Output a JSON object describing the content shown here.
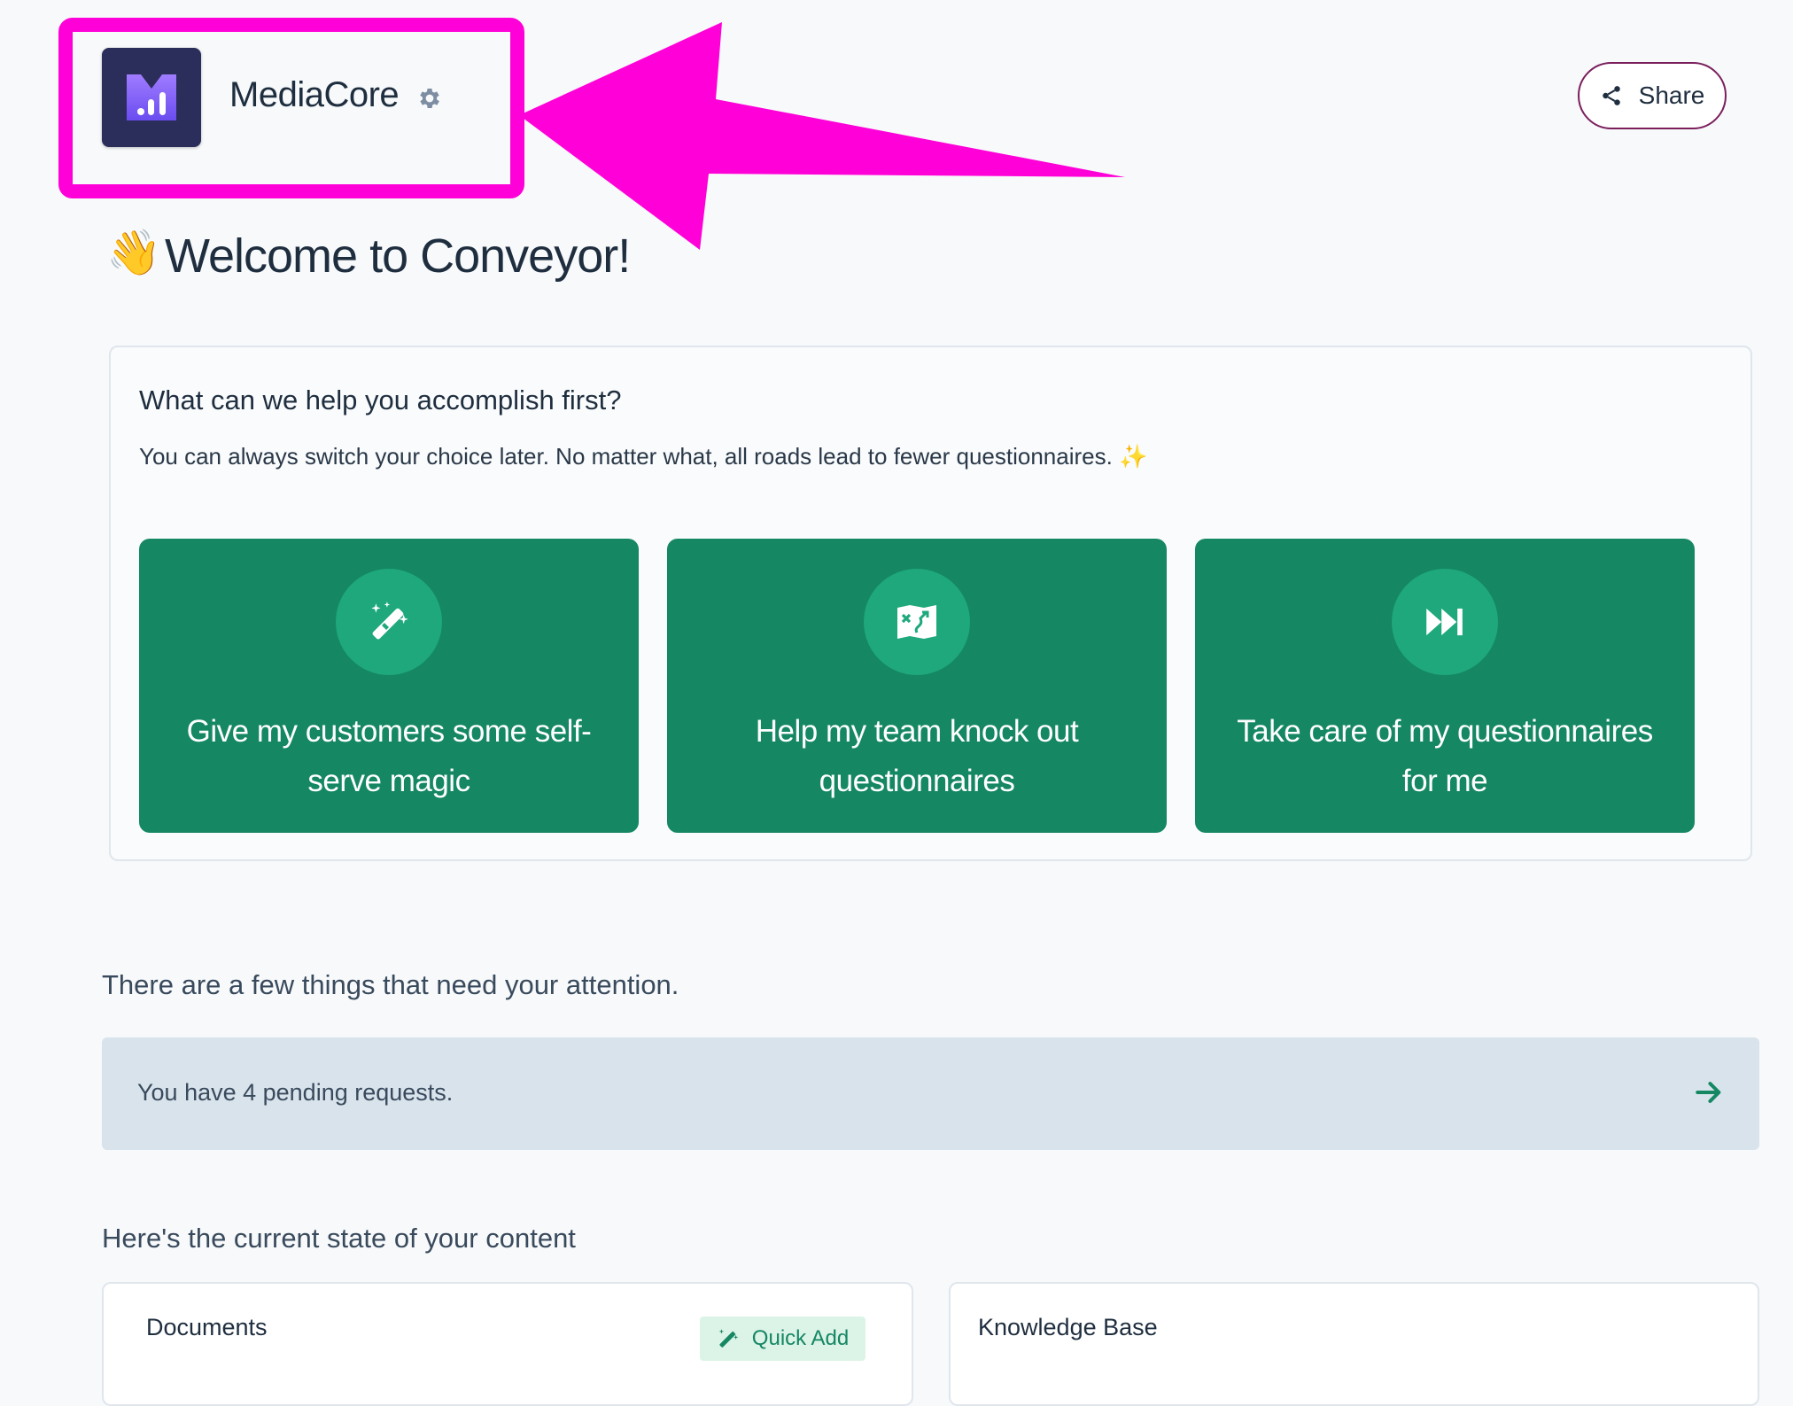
{
  "brand": {
    "name": "MediaCore",
    "logo_icon": "mediacore-logo",
    "settings_icon": "gear-icon"
  },
  "header": {
    "share_label": "Share",
    "share_icon": "share-icon"
  },
  "welcome": {
    "emoji": "👋",
    "title": "Welcome to Conveyor!"
  },
  "onboarding": {
    "title": "What can we help you accomplish first?",
    "subtitle": "You can always switch your choice later. No matter what, all roads lead to fewer questionnaires. ✨",
    "choices": [
      {
        "label": "Give my customers some self-serve magic",
        "icon": "magic-wand-icon"
      },
      {
        "label": "Help my team knock out questionnaires",
        "icon": "playbook-icon"
      },
      {
        "label": "Take care of my questionnaires for me",
        "icon": "fast-forward-icon"
      }
    ]
  },
  "attention": {
    "title": "There are a few things that need your attention.",
    "pending_text": "You have 4 pending requests.",
    "arrow_icon": "arrow-right-icon"
  },
  "content": {
    "title": "Here's the current state of your content",
    "documents": {
      "title": "Documents",
      "quick_add_label": "Quick Add",
      "quick_add_icon": "magic-wand-icon"
    },
    "knowledge_base": {
      "title": "Knowledge Base"
    }
  },
  "colors": {
    "accent_green": "#158763",
    "annotation_magenta": "#ff00d8",
    "background": "#f7f9fb",
    "banner": "#d9e3ec"
  }
}
